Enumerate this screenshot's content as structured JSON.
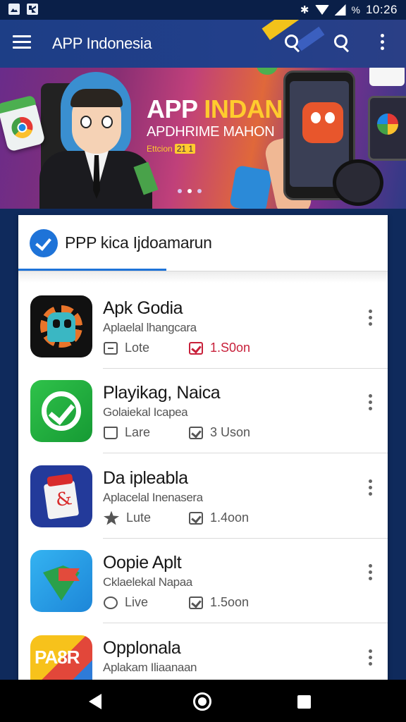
{
  "status_bar": {
    "time": "10:26",
    "battery_text": "%",
    "icons": [
      "photo-icon",
      "notification-icon",
      "bluetooth-icon",
      "wifi-icon",
      "signal-icon"
    ]
  },
  "app_bar": {
    "title": "APP Indonesia",
    "icons": [
      "menu-icon",
      "search-icon",
      "search-icon",
      "more-icon"
    ]
  },
  "banner": {
    "title_a": "APP ",
    "title_b": "INDAN",
    "subtitle": "APDHRIME MAHON",
    "badge_text": "Ettcion",
    "badge_num": "21 1",
    "dots": 3,
    "active_dot": 2
  },
  "card": {
    "header_title": "PPP kica Ijdoamarun"
  },
  "apps": [
    {
      "name": "Apk Godia",
      "subtitle": "Aplaelal lhangcara",
      "meta1_label": "Lote",
      "meta1_icon": "box-icon",
      "meta2_label": "1.S0on",
      "meta2_icon": "download-icon",
      "meta2_color": "#c8203a"
    },
    {
      "name": "Playikag, Naica",
      "subtitle": "Golaiekal Icapea",
      "meta1_label": "Lare",
      "meta1_icon": "bag-icon",
      "meta2_label": "3 Uson",
      "meta2_icon": "download-icon",
      "meta2_color": "#555555"
    },
    {
      "name": "Da ipleabla",
      "subtitle": "Aplacelal Inenasera",
      "meta1_label": "Lute",
      "meta1_icon": "star-icon",
      "meta2_label": "1.4oon",
      "meta2_icon": "download-icon",
      "meta2_color": "#555555"
    },
    {
      "name": "Oopie Aplt",
      "subtitle": "Cklaelekal Napaa",
      "meta1_label": "Live",
      "meta1_icon": "round-icon",
      "meta2_label": "1.5oon",
      "meta2_icon": "download-icon",
      "meta2_color": "#555555"
    },
    {
      "name": "Opplonala",
      "subtitle": "Aplakam Iliaanaan",
      "icon_text": "PA8R"
    }
  ],
  "nav": {
    "icons": [
      "back-icon",
      "home-icon",
      "recents-icon"
    ]
  }
}
